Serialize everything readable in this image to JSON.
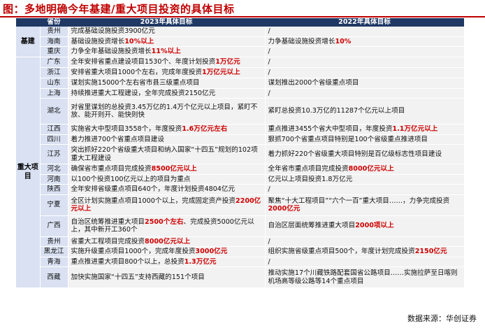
{
  "title": "图：多地明确今年基建/重大项目投资的具体目标",
  "source": "数据来源：华创证券",
  "headers": [
    "",
    "省份",
    "2023年具体目标",
    "2022年具体目标"
  ],
  "categories": {
    "infra": "基建",
    "major": "重大项目"
  },
  "rows": [
    {
      "prov": "贵州",
      "y23": [
        {
          "t": "完成基础设施投资3900亿元"
        }
      ],
      "y22": [
        {
          "t": "/"
        }
      ]
    },
    {
      "prov": "海南",
      "y23": [
        {
          "t": "基础设施投资增长"
        },
        {
          "t": "10%以上",
          "r": true
        }
      ],
      "y22": [
        {
          "t": "力争基础设施投资增长"
        },
        {
          "t": "10%",
          "r": true
        }
      ]
    },
    {
      "prov": "重庆",
      "y23": [
        {
          "t": "力争全年基础设施投资增长"
        },
        {
          "t": "11%以上",
          "r": true
        }
      ],
      "y22": [
        {
          "t": "/"
        }
      ]
    },
    {
      "prov": "广东",
      "y23": [
        {
          "t": "全年安排省重点建设项目1530个、年度计划投资"
        },
        {
          "t": "1万亿元",
          "r": true
        }
      ],
      "y22": [
        {
          "t": "/"
        }
      ]
    },
    {
      "prov": "浙江",
      "y23": [
        {
          "t": "安排省重大项目1000个左右，完成年度投资"
        },
        {
          "t": "1万亿元以上",
          "r": true
        }
      ],
      "y22": [
        {
          "t": "/"
        }
      ]
    },
    {
      "prov": "山东",
      "y23": [
        {
          "t": "谋划实施15000个左右省市县三级重点项目"
        }
      ],
      "y22": [
        {
          "t": "谋划推出2000个省级重点项目"
        }
      ]
    },
    {
      "prov": "上海",
      "y23": [
        {
          "t": "持续推进重大工程建设，全年完成投资2150亿元"
        }
      ],
      "y22": [
        {
          "t": "/"
        }
      ]
    },
    {
      "prov": "湖北",
      "y23": [
        {
          "t": "对省里谋划的总投资3.45万亿的1.4万个亿元以上项目，紧盯不放、能开则开、能快则快"
        }
      ],
      "y22": [
        {
          "t": "紧盯总投资10.3万亿的11287个亿元以上项目"
        }
      ]
    },
    {
      "prov": "江西",
      "y23": [
        {
          "t": "实施省大中型项目3558个，年度投资"
        },
        {
          "t": "1.6万亿元左右",
          "r": true
        }
      ],
      "y22": [
        {
          "t": "重点推进3455个省大中型项目，年度投资"
        },
        {
          "t": "1.1万亿元以上",
          "r": true
        }
      ]
    },
    {
      "prov": "四川",
      "y23": [
        {
          "t": "着力推进700个省重点项目建设"
        }
      ],
      "y22": [
        {
          "t": "狠抓700个省重点项目特别是100个省级重点推进项目"
        }
      ]
    },
    {
      "prov": "江苏",
      "y23": [
        {
          "t": "突出抓好220个省级重大项目和纳入国家“十四五”规划的102项重大工程建设"
        }
      ],
      "y22": [
        {
          "t": "着力抓好220个省级重大项目特别是百亿级标志性项目建设"
        }
      ]
    },
    {
      "prov": "河北",
      "y23": [
        {
          "t": "确保省市重点项目完成投资"
        },
        {
          "t": "8500亿元以上",
          "r": true
        }
      ],
      "y22": [
        {
          "t": "全年省市重点项目完成投资"
        },
        {
          "t": "8000亿元以上",
          "r": true
        }
      ]
    },
    {
      "prov": "河南",
      "y23": [
        {
          "t": "以100个投资100亿元以上的项目为重点"
        }
      ],
      "y22": [
        {
          "t": "亿元以上项目投资1.8万亿元"
        }
      ]
    },
    {
      "prov": "陕西",
      "y23": [
        {
          "t": "全年安排省级重点项目640个，年度计划投资4804亿元"
        }
      ],
      "y22": [
        {
          "t": "/"
        }
      ]
    },
    {
      "prov": "宁夏",
      "y23": [
        {
          "t": "全区计划实施重点项目1000个以上，完成固定资产投资"
        },
        {
          "t": "2200亿元以上",
          "r": true
        }
      ],
      "y22": [
        {
          "t": "聚焦“十大工程项目”“六个一百”重大项目……，力争完成投资"
        },
        {
          "t": "2000亿元",
          "r": true
        }
      ]
    },
    {
      "prov": "广西",
      "y23": [
        {
          "t": "自治区统筹推进重大项目"
        },
        {
          "t": "2500个左右",
          "r": true
        },
        {
          "t": "、完成投资5000亿元以上，其中新开工360个"
        }
      ],
      "y22": [
        {
          "t": "自治区层面统筹推进重大项目"
        },
        {
          "t": "2000项以上",
          "r": true
        }
      ]
    },
    {
      "prov": "贵州",
      "y23": [
        {
          "t": "省重大工程项目完成投资"
        },
        {
          "t": "8000亿元以上",
          "r": true
        }
      ],
      "y22": [
        {
          "t": "/"
        }
      ]
    },
    {
      "prov": "黑龙江",
      "y23": [
        {
          "t": "实施升级重点项目1000个，完成年度投资"
        },
        {
          "t": "3000亿元",
          "r": true
        }
      ],
      "y22": [
        {
          "t": "组织实施省级重点项目500个，年度计划完成投资"
        },
        {
          "t": "2150亿元",
          "r": true
        }
      ]
    },
    {
      "prov": "青海",
      "y23": [
        {
          "t": "重点推进重大项目800个以上，总投资"
        },
        {
          "t": "1.3万亿元",
          "r": true
        }
      ],
      "y22": [
        {
          "t": "/"
        }
      ]
    },
    {
      "prov": "西藏",
      "y23": [
        {
          "t": "加快实施国家“十四五”支持西藏的151个项目"
        }
      ],
      "y22": [
        {
          "t": "推动实施17个川藏铁路配套国省公路项目……实施拉萨至日喀则机场高等级公路等14个重点项目"
        }
      ]
    }
  ],
  "colors": {
    "header_bg": "#1f3864",
    "category_bg": "#d9e1f2",
    "cell_bg": "#f2f2f2",
    "highlight": "#d00000",
    "title": "#c00000"
  }
}
